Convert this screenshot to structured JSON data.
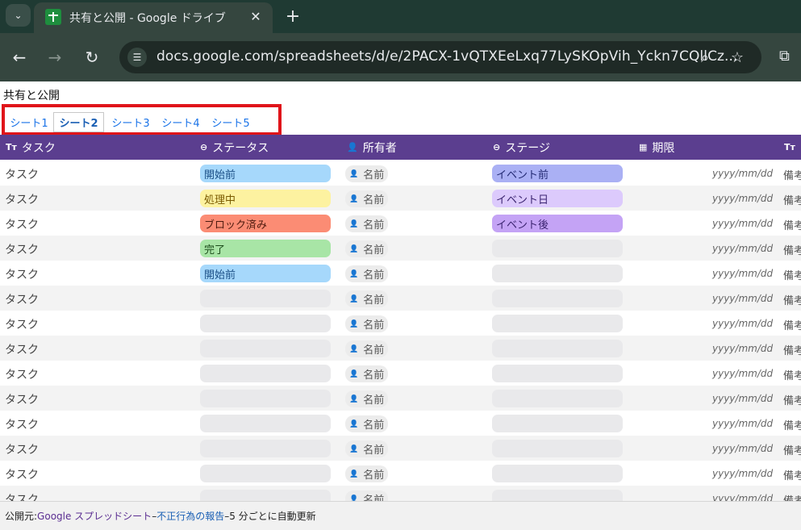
{
  "browser": {
    "tab_title": "共有と公開 - Google ドライブ",
    "tab_close": "✕",
    "new_tab": "+",
    "url": "docs.google.com/spreadsheets/d/e/2PACX-1vQTXEeLxq77LySKOpVih_Yckn7CQllCz..."
  },
  "page": {
    "title": "共有と公開"
  },
  "sheet_tabs": [
    {
      "label": "シート1",
      "active": false
    },
    {
      "label": "シート2",
      "active": true
    },
    {
      "label": "シート3",
      "active": false
    },
    {
      "label": "シート4",
      "active": false
    },
    {
      "label": "シート5",
      "active": false
    }
  ],
  "columns": {
    "task": {
      "label": "タスク",
      "icon": "Tт"
    },
    "status": {
      "label": "ステータス",
      "icon": "⊖"
    },
    "owner": {
      "label": "所有者",
      "icon": "👤"
    },
    "stage": {
      "label": "ステージ",
      "icon": "⊖"
    },
    "due": {
      "label": "期限",
      "icon": "▦"
    },
    "note": {
      "icon": "Tт"
    }
  },
  "colors": {
    "header_bg": "#5b3e8f",
    "status": {
      "開始前": "#a6d8fb",
      "処理中": "#fdf2a0",
      "ブロック済み": "#fb8c74",
      "完了": "#a8e5a6"
    },
    "status_text": {
      "開始前": "#1b4f86",
      "処理中": "#7a5a00",
      "ブロック済み": "#4e1b0f",
      "完了": "#1d4d1c"
    },
    "stage": {
      "イベント前": "#aab0f4",
      "イベント日": "#dccafc",
      "イベント後": "#c4a3f5"
    },
    "stage_text": {
      "イベント前": "#232a73",
      "イベント日": "#3b2470",
      "イベント後": "#3b2470"
    }
  },
  "rows": [
    {
      "task": "タスク",
      "status": "開始前",
      "owner": "名前",
      "stage": "イベント前",
      "due": "yyyy/mm/dd",
      "note": "備考"
    },
    {
      "task": "タスク",
      "status": "処理中",
      "owner": "名前",
      "stage": "イベント日",
      "due": "yyyy/mm/dd",
      "note": "備考"
    },
    {
      "task": "タスク",
      "status": "ブロック済み",
      "owner": "名前",
      "stage": "イベント後",
      "due": "yyyy/mm/dd",
      "note": "備考"
    },
    {
      "task": "タスク",
      "status": "完了",
      "owner": "名前",
      "stage": "",
      "due": "yyyy/mm/dd",
      "note": "備考"
    },
    {
      "task": "タスク",
      "status": "開始前",
      "owner": "名前",
      "stage": "",
      "due": "yyyy/mm/dd",
      "note": "備考"
    },
    {
      "task": "タスク",
      "status": "",
      "owner": "名前",
      "stage": "",
      "due": "yyyy/mm/dd",
      "note": "備考"
    },
    {
      "task": "タスク",
      "status": "",
      "owner": "名前",
      "stage": "",
      "due": "yyyy/mm/dd",
      "note": "備考"
    },
    {
      "task": "タスク",
      "status": "",
      "owner": "名前",
      "stage": "",
      "due": "yyyy/mm/dd",
      "note": "備考"
    },
    {
      "task": "タスク",
      "status": "",
      "owner": "名前",
      "stage": "",
      "due": "yyyy/mm/dd",
      "note": "備考"
    },
    {
      "task": "タスク",
      "status": "",
      "owner": "名前",
      "stage": "",
      "due": "yyyy/mm/dd",
      "note": "備考"
    },
    {
      "task": "タスク",
      "status": "",
      "owner": "名前",
      "stage": "",
      "due": "yyyy/mm/dd",
      "note": "備考"
    },
    {
      "task": "タスク",
      "status": "",
      "owner": "名前",
      "stage": "",
      "due": "yyyy/mm/dd",
      "note": "備考"
    },
    {
      "task": "タスク",
      "status": "",
      "owner": "名前",
      "stage": "",
      "due": "yyyy/mm/dd",
      "note": "備考"
    },
    {
      "task": "タスク",
      "status": "",
      "owner": "名前",
      "stage": "",
      "due": "yyyy/mm/dd",
      "note": "備考"
    }
  ],
  "footer": {
    "prefix": "公開元: ",
    "publisher": "Google スプレッドシート",
    "sep1": " – ",
    "report": "不正行為の報告",
    "sep2": " – ",
    "auto_update": "5 分ごとに自動更新"
  }
}
